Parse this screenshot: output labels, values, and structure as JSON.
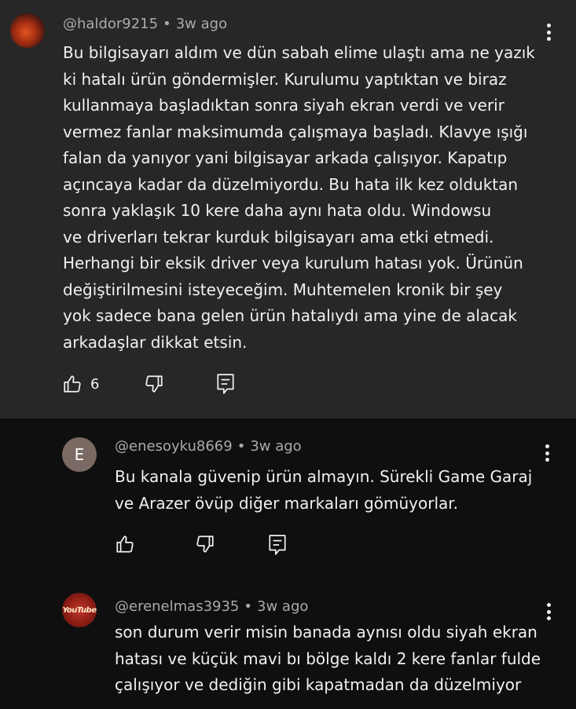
{
  "colors": {
    "page_background": "#0f0f0f",
    "highlighted_comment_background": "#272727",
    "text_primary": "#f1f1f1",
    "text_secondary": "#aaaaaa",
    "avatar_e_background": "#7a6a63"
  },
  "comments": [
    {
      "author": "@haldor9215",
      "time": "3w ago",
      "avatar_icon": "channel-avatar-orange",
      "lines": [
        "Bu bilgisayarı aldım ve dün sabah elime ulaştı ama ne yazık",
        "ki hatalı ürün göndermişler. Kurulumu yaptıktan ve biraz",
        "kullanmaya başladıktan sonra siyah ekran verdi ve verir",
        "vermez fanlar maksimumda çalışmaya başladı. Klavye ışığı",
        "falan da yanıyor yani bilgisayar arkada çalışıyor. Kapatıp",
        "açıncaya kadar da düzelmiyordu. Bu hata ilk kez olduktan",
        "sonra yaklaşık 10 kere daha aynı hata oldu. Windowsu",
        "ve driverları tekrar kurduk bilgisayarı ama etki etmedi.",
        "Herhangi bir eksik driver veya kurulum hatası yok. Ürünün",
        "değiştirilmesini isteyeceğim. Muhtemelen kronik bir şey",
        "yok sadece bana gelen ürün hatalıydı ama yine de alacak",
        "arkadaşlar dikkat etsin."
      ],
      "like_count": "6",
      "highlighted": true
    },
    {
      "author": "@enesoyku8669",
      "time": "3w ago",
      "avatar_letter": "E",
      "lines": [
        "Bu kanala güvenip ürün almayın. Sürekli Game Garaj",
        "ve Arazer övüp diğer markaları gömüyorlar."
      ],
      "like_count": ""
    },
    {
      "author": "@erenelmas3935",
      "time": "3w ago",
      "avatar_text": "YouTube",
      "lines": [
        "son durum verir misin banada aynısı oldu siyah ekran",
        "hatası ve küçük mavi bı bölge kaldı 2 kere fanlar fulde",
        "çalışıyor ve dediğin gibi kapatmadan da düzelmiyor"
      ]
    }
  ],
  "separator": "•",
  "icons": {
    "like": "thumb-up-icon",
    "dislike": "thumb-down-icon",
    "reply": "reply-icon",
    "menu": "more-vert-icon"
  }
}
